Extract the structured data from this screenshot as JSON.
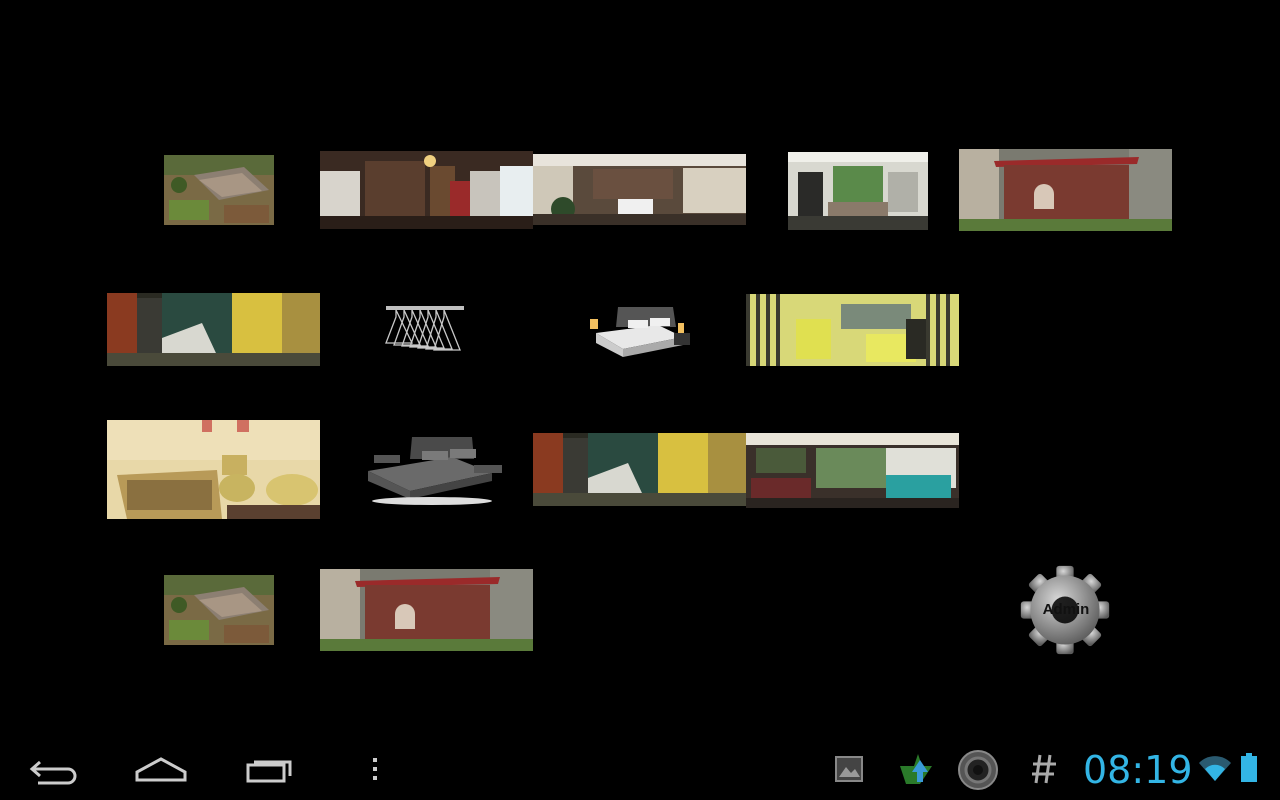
{
  "gallery": {
    "items": [
      {
        "name": "aerial-house-photo-thumbnail"
      },
      {
        "name": "living-room-panorama-thumbnail"
      },
      {
        "name": "lobby-panorama-thumbnail"
      },
      {
        "name": "dining-room-panorama-thumbnail"
      },
      {
        "name": "dog-house-photo-thumbnail"
      },
      {
        "name": "hallway-panorama-thumbnail"
      },
      {
        "name": "coat-hangers-thumbnail"
      },
      {
        "name": "white-bed-thumbnail"
      },
      {
        "name": "yellow-bathroom-panorama-thumbnail"
      },
      {
        "name": "bathroom-photo-thumbnail"
      },
      {
        "name": "grey-bed-thumbnail"
      },
      {
        "name": "hallway-panorama-2-thumbnail"
      },
      {
        "name": "bedroom-panorama-thumbnail"
      },
      {
        "name": "aerial-house-photo-2-thumbnail"
      },
      {
        "name": "dog-house-photo-2-thumbnail"
      }
    ]
  },
  "admin": {
    "label": "Admin",
    "icon": "gear-icon"
  },
  "navbar": {
    "back_icon": "back-icon",
    "home_icon": "home-icon",
    "recents_icon": "recent-apps-icon",
    "menu_icon": "overflow-menu-icon"
  },
  "status": {
    "time": "08:19",
    "clock_color": "#33b5e5",
    "icons": [
      "gallery-notification-icon",
      "upload-notification-icon",
      "camera-notification-icon",
      "hash-notification-icon",
      "wifi-icon",
      "battery-icon"
    ]
  }
}
